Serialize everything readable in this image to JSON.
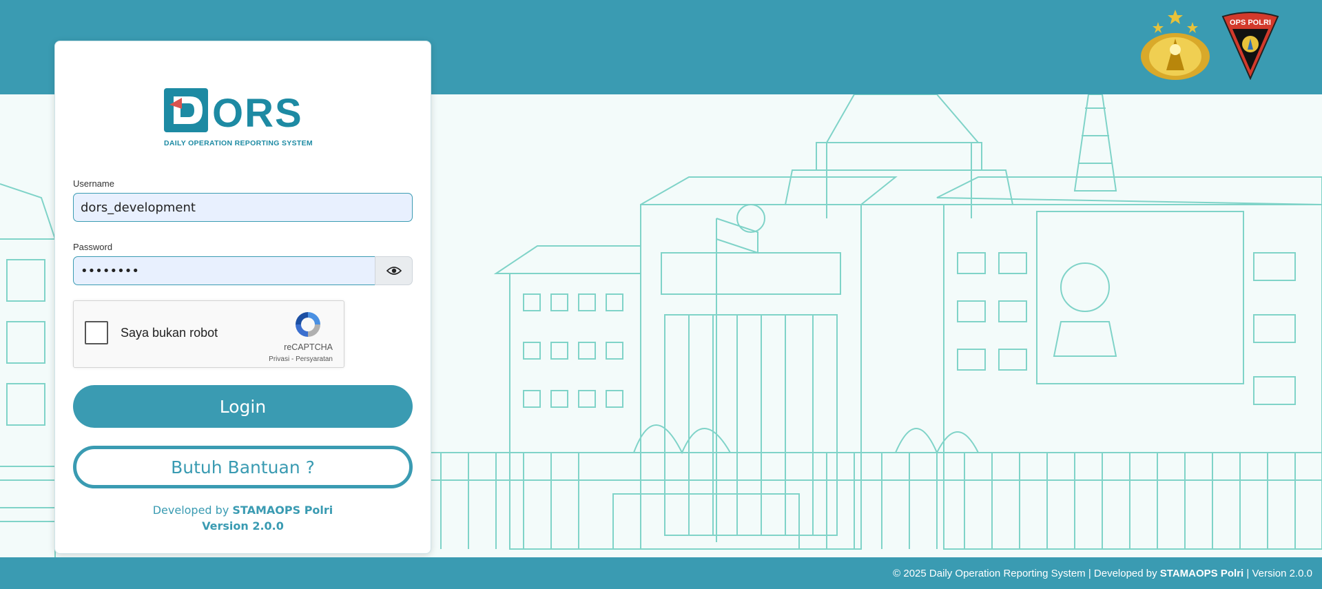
{
  "logo": {
    "wordmark": "ORS",
    "letter": "D",
    "tagline": "DAILY OPERATION REPORTING SYSTEM"
  },
  "emblems": {
    "left_icon": "police-emblem-icon",
    "right_icon": "ops-polri-emblem-icon",
    "right_text": "OPS POLRI"
  },
  "form": {
    "username_label": "Username",
    "username_value": "dors_development",
    "password_label": "Password",
    "password_value": "••••••••",
    "toggle_icon": "eye-icon"
  },
  "recaptcha": {
    "label": "Saya bukan robot",
    "brand": "reCAPTCHA",
    "privacy": "Privasi",
    "separator": "-",
    "terms": "Persyaratan"
  },
  "buttons": {
    "login": "Login",
    "help": "Butuh Bantuan ?"
  },
  "card_footer": {
    "developed_by": "Developed by",
    "developer": "STAMAOPS Polri",
    "version": "Version 2.0.0"
  },
  "page_footer": {
    "copyright": "© 2025 Daily Operation Reporting System | Developed by",
    "developer": "STAMAOPS Polri",
    "version": "| Version 2.0.0"
  },
  "colors": {
    "primary": "#3a9bb2",
    "logo_blue": "#1d8aa3",
    "logo_red": "#d9534f",
    "field_bg": "#e8f0fe",
    "illustration": "#7fd3c8"
  }
}
